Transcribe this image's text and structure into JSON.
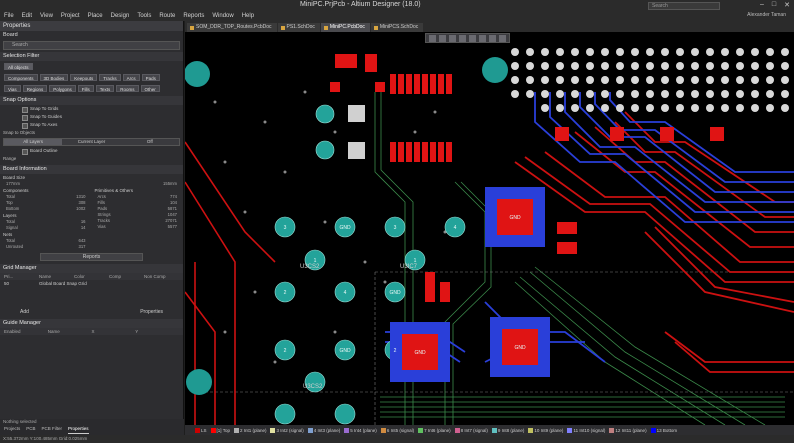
{
  "window": {
    "title": "MiniPC.PrjPcb - Altium Designer (18.0)",
    "search_placeholder": "Search",
    "user": "Alexander Taman"
  },
  "menu": [
    "File",
    "Edit",
    "View",
    "Project",
    "Place",
    "Design",
    "Tools",
    "Route",
    "Reports",
    "Window",
    "Help"
  ],
  "panel": {
    "title": "Properties",
    "subtitle": "Board",
    "search_placeholder": "Search",
    "selection_filter": {
      "heading": "Selection Filter",
      "all_objects": "All objects",
      "row1": [
        "Components",
        "3D Bodies",
        "Keepouts",
        "Tracks",
        "Arcs",
        "Pads"
      ],
      "row2": [
        "Vias",
        "Regions",
        "Polygons",
        "Fills",
        "Texts",
        "Rooms",
        "Other"
      ]
    },
    "snap_options": {
      "heading": "Snap Options",
      "checks": [
        "Snap To Grids",
        "Snap To Guides",
        "Snap To Axes"
      ],
      "objects_label": "Snap to Objects",
      "segment": [
        "All Layers",
        "Current Layer",
        "Off"
      ],
      "board_outline": "Board Outline",
      "range_label": "Range"
    },
    "board_info": {
      "heading": "Board Information",
      "size_label": "Board Size",
      "horizontal": "177mm",
      "vertical": "155mm",
      "components_label": "Components",
      "primitives_label": "Primitives & Others",
      "components": [
        [
          "Total",
          "1310"
        ],
        [
          "Top",
          "308"
        ],
        [
          "Bottom",
          "1002"
        ]
      ],
      "primitives": [
        [
          "Arcs",
          "774"
        ],
        [
          "Fills",
          "104"
        ],
        [
          "Pads",
          "5871"
        ],
        [
          "Strings",
          "1047"
        ],
        [
          "Tracks",
          "27071"
        ],
        [
          "Vias",
          "5577"
        ]
      ],
      "layers_label": "Layers",
      "layers": [
        [
          "Total",
          "16"
        ],
        [
          "Signal",
          "14"
        ]
      ],
      "nets_label": "Nets",
      "nets": [
        [
          "Total",
          "643"
        ],
        [
          "Unrouted",
          "317"
        ]
      ],
      "reports_button": "Reports"
    },
    "grid_manager": {
      "heading": "Grid Manager",
      "columns": [
        "Pri...",
        "Name",
        "Color",
        "Comp",
        "Non Comp"
      ],
      "rows": [
        [
          "50",
          "Global Board Snap Grid"
        ]
      ],
      "add_button": "Add",
      "properties_button": "Properties"
    },
    "guide_manager": {
      "heading": "Guide Manager",
      "columns": [
        "Enabled",
        "Name",
        "X",
        "Y"
      ]
    },
    "status": "Nothing selected",
    "tabs": [
      "Projects",
      "PCB",
      "PCB Filter",
      "Properties"
    ]
  },
  "doctabs": [
    "SOM_DDR_TOP_Routes.PcbDoc",
    "PS1.SchDoc",
    "MiniPC.PcbDoc",
    "MiniPCS.SchDoc"
  ],
  "doctab_active_index": 2,
  "canvas": {
    "component_labels": [
      "U3CS2",
      "U3CS2",
      "U3IC7"
    ],
    "pad_labels": [
      "3",
      "2",
      "1",
      "4",
      "GND"
    ]
  },
  "layers": [
    {
      "name": "LS",
      "color": "#cc0000"
    },
    {
      "name": "[1] Top",
      "color": "#ff0000"
    },
    {
      "name": "2 Int1 (plane)",
      "color": "#b0b0b0"
    },
    {
      "name": "3 Int2 (signal)",
      "color": "#e0e0a0"
    },
    {
      "name": "4 Int3 (plane)",
      "color": "#7fa0d0"
    },
    {
      "name": "5 Int4 (plane)",
      "color": "#9a6bd0"
    },
    {
      "name": "6 Int5 (signal)",
      "color": "#d08b40"
    },
    {
      "name": "7 Int6 (plane)",
      "color": "#60c060"
    },
    {
      "name": "8 Int7 (signal)",
      "color": "#d06090"
    },
    {
      "name": "9 Int8 (plane)",
      "color": "#60c0c0"
    },
    {
      "name": "10 Int9 (plane)",
      "color": "#c0c060"
    },
    {
      "name": "11 Int10 (signal)",
      "color": "#8080ff"
    },
    {
      "name": "12 Int11 (plane)",
      "color": "#c08080"
    },
    {
      "name": "13 Bottom",
      "color": "#0000ff"
    }
  ],
  "statusbar": "X:55.372mm Y:100.485mm  Grid:0.025mm"
}
